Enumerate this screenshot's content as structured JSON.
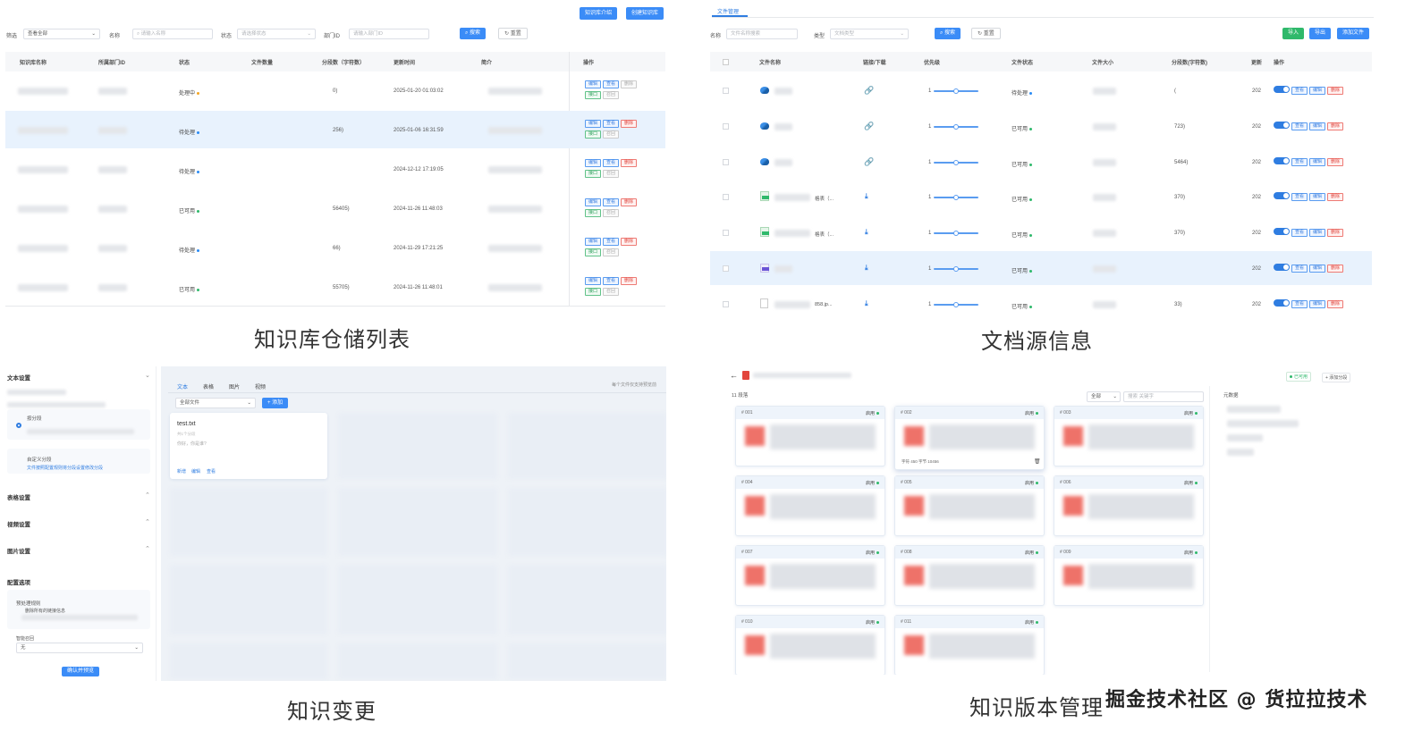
{
  "captions": {
    "top_left": "知识库仓储列表",
    "top_right": "文档源信息",
    "bottom_left": "知识变更",
    "bottom_right": "知识版本管理",
    "watermark_credit": "掘金技术社区 @ 货拉拉技术"
  },
  "kb_list": {
    "top_buttons": [
      "知识库介绍",
      "创建知识库"
    ],
    "filter_label": "筛选",
    "filter_value": "查看全部",
    "name_label": "名称",
    "name_placeholder": "请输入名称",
    "status_label": "状态",
    "status_placeholder": "请选择状态",
    "dept_label": "部门ID",
    "dept_placeholder": "请输入部门ID",
    "search_btn": "搜索",
    "reset_btn": "重置",
    "columns": [
      "知识库名称",
      "所属部门ID",
      "状态",
      "文件数量",
      "分段数（字符数）",
      "更新时间",
      "简介",
      "操作"
    ],
    "rows": [
      {
        "status": "处理中",
        "status_color": "#f5a623",
        "segments": "0)",
        "time": "2025-01-20 01:03:02",
        "ops": [
          "编辑",
          "查看",
          "删除",
          "接口",
          "召回"
        ]
      },
      {
        "status": "待处理",
        "status_color": "#2b8cf5",
        "segments": "256)",
        "time": "2025-01-06 16:31:59",
        "ops": [
          "编辑",
          "查看",
          "删除",
          "接口",
          "召回"
        ]
      },
      {
        "status": "待处理",
        "status_color": "#2b8cf5",
        "segments": "",
        "time": "2024-12-12 17:19:05",
        "ops": [
          "编辑",
          "查看",
          "删除",
          "接口",
          "召回"
        ]
      },
      {
        "status": "已可用",
        "status_color": "#2fb96b",
        "segments": "56405)",
        "time": "2024-11-26 11:48:03",
        "ops": [
          "编辑",
          "查看",
          "删除",
          "接口",
          "召回"
        ]
      },
      {
        "status": "待处理",
        "status_color": "#2b8cf5",
        "segments": "66)",
        "time": "2024-11-29 17:21:25",
        "ops": [
          "编辑",
          "查看",
          "删除",
          "接口",
          "召回"
        ]
      },
      {
        "status": "已可用",
        "status_color": "#2fb96b",
        "segments": "55705)",
        "time": "2024-11-26 11:48:01",
        "ops": [
          "编辑",
          "查看",
          "删除",
          "接口",
          "召回"
        ]
      }
    ]
  },
  "doc_source": {
    "tab": "文件管理",
    "name_label": "名称",
    "name_placeholder": "文件名称搜索",
    "type_label": "类型",
    "type_placeholder": "文档类型",
    "search_btn": "搜索",
    "reset_btn": "重置",
    "action_buttons": [
      "导入",
      "导出",
      "添加文件"
    ],
    "columns": [
      "文件名称",
      "链接/下载",
      "优先级",
      "文件状态",
      "文件大小",
      "分段数(字符数)",
      "更新",
      "操作"
    ],
    "rows": [
      {
        "icon": "web",
        "name_suffix": "",
        "link": "link",
        "priority": "1",
        "status": "待处理",
        "status_color": "#2b8cf5",
        "segments": "(",
        "upd": "202"
      },
      {
        "icon": "web",
        "name_suffix": "",
        "link": "link",
        "priority": "1",
        "status": "已可用",
        "status_color": "#2fb96b",
        "segments": "723)",
        "upd": "202"
      },
      {
        "icon": "web",
        "name_suffix": "",
        "link": "link",
        "priority": "1",
        "status": "已可用",
        "status_color": "#2fb96b",
        "segments": "5464)",
        "upd": "202"
      },
      {
        "icon": "xls",
        "name_suffix": "格表（...",
        "link": "download",
        "priority": "1",
        "status": "已可用",
        "status_color": "#2fb96b",
        "segments": "370)",
        "upd": "202"
      },
      {
        "icon": "xls",
        "name_suffix": "格表（...",
        "link": "download",
        "priority": "1",
        "status": "已可用",
        "status_color": "#2fb96b",
        "segments": "370)",
        "upd": "202"
      },
      {
        "icon": "img",
        "name_suffix": "",
        "link": "download",
        "priority": "1",
        "status": "已可用",
        "status_color": "#2fb96b",
        "segments": "",
        "upd": "202"
      },
      {
        "icon": "file",
        "name_suffix": "858.jp...",
        "link": "download",
        "priority": "1",
        "status": "已可用",
        "status_color": "#2fb96b",
        "segments": "33)",
        "upd": "202"
      }
    ],
    "row_ops": [
      "启用",
      "查看",
      "编辑",
      "删除"
    ]
  },
  "knowledge_change": {
    "sections": [
      "文本设置",
      "表格设置",
      "视频设置",
      "图片设置",
      "配置选项"
    ],
    "option1": "按分段",
    "option2": "自定义分段",
    "option2_desc": "文件按照配置规则将分段设置修改分段",
    "preprocess_label": "预处理规则",
    "preprocess_desc": "删除所有的链接信息",
    "recall_label": "智能召回",
    "recall_value": "无",
    "confirm_btn": "确认并预览",
    "tabs": [
      "文本",
      "表格",
      "图片",
      "视频"
    ],
    "right_hint": "每个文件仅支持预览前",
    "all_files": "全部文件",
    "add_btn": "+ 添加",
    "file_name": "test.txt",
    "file_meta": "共1个分段",
    "file_sub": "你好，你是谁?",
    "file_actions": [
      "新增",
      "编辑",
      "查看"
    ]
  },
  "version_mgmt": {
    "count_label": "11 段落",
    "filter_all": "全部",
    "search_placeholder": "搜索  关键字",
    "status_badge": "已可用",
    "add_btn": "+ 添加分段",
    "side_title": "元数据",
    "cards": [
      {
        "num": "# 001",
        "status": "启用"
      },
      {
        "num": "# 002",
        "status": "启用"
      },
      {
        "num": "# 003",
        "status": "启用"
      },
      {
        "num": "# 004",
        "status": "启用"
      },
      {
        "num": "# 005",
        "status": "启用"
      },
      {
        "num": "# 006",
        "status": "启用"
      },
      {
        "num": "# 007",
        "status": "启用"
      },
      {
        "num": "# 008",
        "status": "启用"
      },
      {
        "num": "# 009",
        "status": "启用"
      },
      {
        "num": "# 010",
        "status": "启用"
      },
      {
        "num": "# 011",
        "status": "启用"
      }
    ],
    "card_footer": "字符 450  字节 10456"
  }
}
